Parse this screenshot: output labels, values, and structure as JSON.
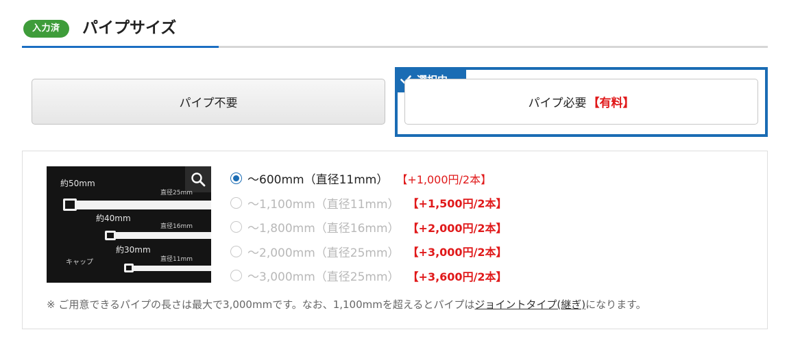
{
  "header": {
    "badge": "入力済",
    "title": "パイプサイズ"
  },
  "choices": {
    "no_pipe_label": "パイプ不要",
    "need_pipe_label": "パイプ必要",
    "need_pipe_paid": "【有料】",
    "selected_tag": "選択中"
  },
  "photo": {
    "label_50": "約50mm",
    "label_40": "約40mm",
    "label_30": "約30mm",
    "dia_25": "直径25mm",
    "dia_16": "直径16mm",
    "dia_11": "直径11mm",
    "cap_label": "キャップ"
  },
  "size_options": [
    {
      "label": "～600mm（直径11mm）",
      "price": "【+1,000円/2本】",
      "selected": true,
      "enabled": true
    },
    {
      "label": "～1,100mm（直径11mm）",
      "price": "【+1,500円/2本】",
      "selected": false,
      "enabled": false
    },
    {
      "label": "～1,800mm（直径16mm）",
      "price": "【+2,000円/2本】",
      "selected": false,
      "enabled": false
    },
    {
      "label": "～2,000mm（直径25mm）",
      "price": "【+3,000円/2本】",
      "selected": false,
      "enabled": false
    },
    {
      "label": "～3,000mm（直径25mm）",
      "price": "【+3,600円/2本】",
      "selected": false,
      "enabled": false
    }
  ],
  "note": {
    "prefix": "※ ご用意できるパイプの長さは最大で3,000mmです。なお、1,100mmを超えるとパイプは",
    "link": "ジョイントタイプ(継ぎ)",
    "suffix": "になります。"
  },
  "colors": {
    "accent": "#1a6cb4",
    "badge": "#3e9c3a",
    "price": "#e0191a"
  }
}
